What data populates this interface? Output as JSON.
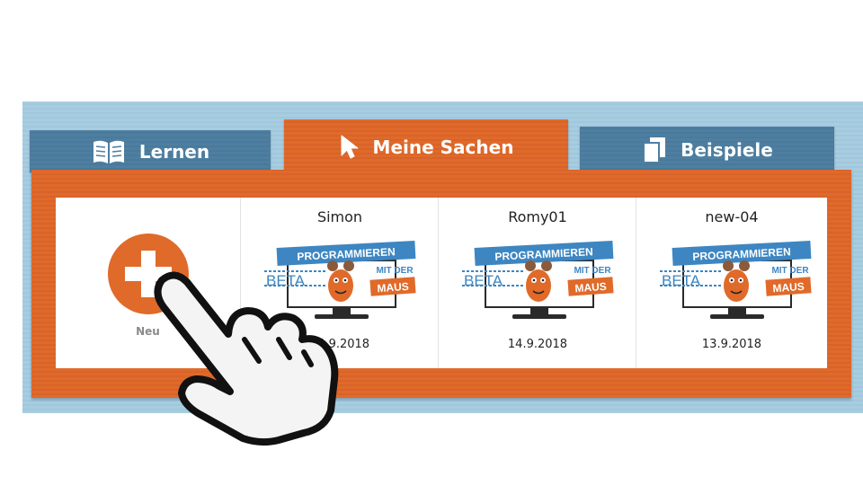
{
  "tabs": [
    {
      "label": "Lernen",
      "icon": "book-icon",
      "active": false
    },
    {
      "label": "Meine Sachen",
      "icon": "cursor-icon",
      "active": true
    },
    {
      "label": "Beispiele",
      "icon": "copy-icon",
      "active": false
    }
  ],
  "new_card": {
    "label": "Neu",
    "icon": "plus-icon"
  },
  "projects": [
    {
      "name": "Simon",
      "date": "14.9.2018",
      "thumbnail": {
        "line1": "PROGRAMMIEREN",
        "line2": "MIT DER",
        "line3": "MAUS",
        "badge": "BETA"
      }
    },
    {
      "name": "Romy01",
      "date": "14.9.2018",
      "thumbnail": {
        "line1": "PROGRAMMIEREN",
        "line2": "MIT DER",
        "line3": "MAUS",
        "badge": "BETA"
      }
    },
    {
      "name": "new-04",
      "date": "13.9.2018",
      "thumbnail": {
        "line1": "PROGRAMMIEREN",
        "line2": "MIT DER",
        "line3": "MAUS",
        "badge": "BETA"
      }
    }
  ],
  "colors": {
    "orange": "#e06a2a",
    "blue": "#4e7fa1",
    "sky": "#a8cde0",
    "logo_blue": "#3d86c2"
  }
}
